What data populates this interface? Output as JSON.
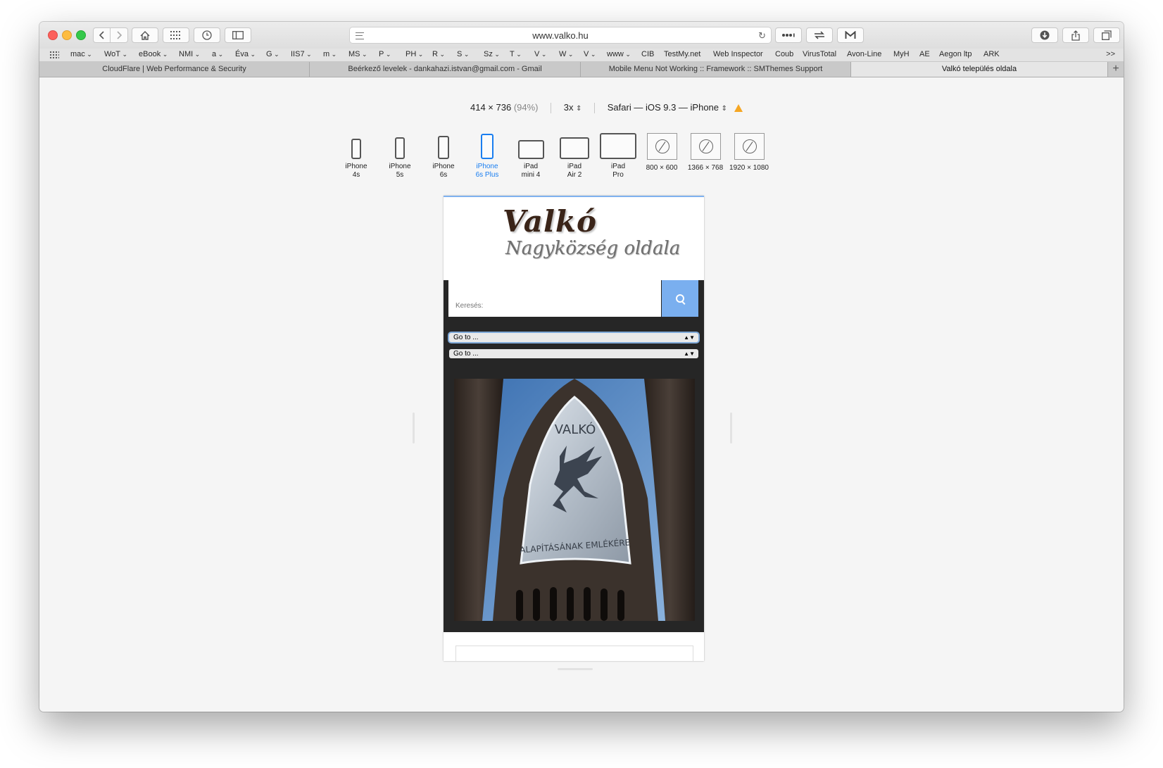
{
  "window": {
    "url": "www.valko.hu"
  },
  "favorites": [
    {
      "label": "mac",
      "menu": true
    },
    {
      "label": "WoT",
      "menu": true
    },
    {
      "label": "eBook",
      "menu": true
    },
    {
      "label": "NMI",
      "menu": true
    },
    {
      "label": "a",
      "menu": true
    },
    {
      "label": "Éva",
      "menu": true
    },
    {
      "label": "G",
      "menu": true
    },
    {
      "label": "IIS7",
      "menu": true
    },
    {
      "label": "m",
      "menu": true
    },
    {
      "label": "MS",
      "menu": true
    },
    {
      "label": "P",
      "menu": true
    },
    {
      "label": "PH",
      "menu": true
    },
    {
      "label": "R",
      "menu": true
    },
    {
      "label": "S",
      "menu": true
    },
    {
      "label": "Sz",
      "menu": true
    },
    {
      "label": "T",
      "menu": true
    },
    {
      "label": "V",
      "menu": true
    },
    {
      "label": "W",
      "menu": true
    },
    {
      "label": "V",
      "menu": true
    },
    {
      "label": "www",
      "menu": true
    },
    {
      "label": "CIB",
      "menu": false
    },
    {
      "label": "TestMy.net",
      "menu": false
    },
    {
      "label": "Web Inspector",
      "menu": false
    },
    {
      "label": "Coub",
      "menu": false
    },
    {
      "label": "VirusTotal",
      "menu": false
    },
    {
      "label": "Avon-Line",
      "menu": false
    },
    {
      "label": "MyH",
      "menu": false
    },
    {
      "label": "AE",
      "menu": false
    },
    {
      "label": "Aegon ltp",
      "menu": false
    },
    {
      "label": "ARK",
      "menu": false
    }
  ],
  "favorites_more": ">>",
  "tabs": [
    {
      "label": "CloudFlare | Web Performance & Security",
      "active": false
    },
    {
      "label": "Beérkező levelek - dankahazi.istvan@gmail.com - Gmail",
      "active": false
    },
    {
      "label": "Mobile Menu Not Working :: Framework :: SMThemes Support",
      "active": false
    },
    {
      "label": "Valkó település oldala",
      "active": true
    }
  ],
  "tab_add": "+",
  "rdm": {
    "size": "414 × 736",
    "zoom": "(94%)",
    "scale": "3x",
    "agent": "Safari — iOS 9.3 — iPhone"
  },
  "devices": [
    {
      "line1": "iPhone",
      "line2": "4s",
      "selected": false
    },
    {
      "line1": "iPhone",
      "line2": "5s",
      "selected": false
    },
    {
      "line1": "iPhone",
      "line2": "6s",
      "selected": false
    },
    {
      "line1": "iPhone",
      "line2": "6s Plus",
      "selected": true
    },
    {
      "line1": "iPad",
      "line2": "mini 4",
      "selected": false
    },
    {
      "line1": "iPad",
      "line2": "Air 2",
      "selected": false
    },
    {
      "line1": "iPad",
      "line2": "Pro",
      "selected": false
    },
    {
      "line1": "800 × 600",
      "line2": "",
      "selected": false
    },
    {
      "line1": "1366 × 768",
      "line2": "",
      "selected": false
    },
    {
      "line1": "1920 × 1080",
      "line2": "",
      "selected": false
    }
  ],
  "site": {
    "title": "Valkó",
    "subtitle": "Nagyközség oldala",
    "search_placeholder": "Keresés:",
    "menu1": "Go to ...",
    "menu2": "Go to ...",
    "sign_top": "VALKÓ",
    "sign_bottom": "ALAPÍTÁSÁNAK EMLÉKÉRE"
  },
  "colors": {
    "accent": "#1a7ef0",
    "search_button": "#7aafef",
    "site_dark": "#262626"
  }
}
